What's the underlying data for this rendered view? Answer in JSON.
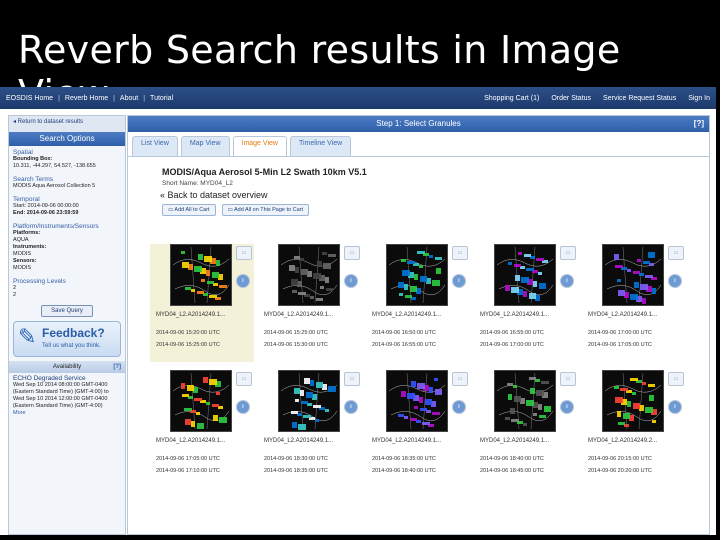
{
  "slide": {
    "title": "Reverb  Search results in Image View"
  },
  "topnav": {
    "left": [
      "EOSDIS Home",
      "Reverb Home",
      "About",
      "Tutorial"
    ],
    "right": [
      "Shopping Cart (1)",
      "Order Status",
      "Service Request Status",
      "Sign In"
    ]
  },
  "sidebar": {
    "return_link": "◂ Return to dataset results",
    "header": "Search Options",
    "spatial": {
      "heading": "Spatial",
      "label": "Bounding Box:",
      "value": "10.311, -44.297, 54.527, -138.655"
    },
    "terms": {
      "heading": "Search Terms",
      "value": "MODIS Aqua Aerosol Collection 5"
    },
    "temporal": {
      "heading": "Temporal",
      "start": "Start: 2014-09-06 00:00:00",
      "end": "End: 2014-09-06 23:59:59"
    },
    "platform": {
      "heading": "Platform/Instruments/Sensors",
      "platforms_label": "Platforms:",
      "platforms_value": "AQUA",
      "instruments_label": "Instruments:",
      "instruments_value": "MODIS",
      "sensors_label": "Sensors:",
      "sensors_value": "MODIS"
    },
    "processing": {
      "heading": "Processing Levels",
      "v1": "2",
      "v2": "2"
    },
    "save_query": "Save Query",
    "feedback": {
      "title": "Feedback?",
      "subtitle": "Tell us what you think."
    },
    "availability": {
      "label": "Availability",
      "help": "[?]"
    },
    "notice": {
      "heading": "ECHO Degraded Service",
      "body": "Wed Sep 10 2014 08:00:00 GMT-0400 (Eastern Standard Time) (GMT-4:00) to Wed Sep 10 2014 12:00:00 GMT-0400 (Eastern Standard Time) (GMT-4:00)",
      "more": "More"
    }
  },
  "main": {
    "header": "Step 1: Select Granules",
    "help": "[?]",
    "tabs": [
      "List View",
      "Map View",
      "Image View",
      "Timeline View"
    ],
    "active_tab": 2,
    "dataset_title": "MODIS/Aqua Aerosol 5-Min L2 Swath 10km V5.1",
    "short_name": "Short Name:   MYD04_L2",
    "back_link": "« Back to dataset overview",
    "add_all_cart": "Add All to Cart",
    "add_page_cart": "Add All on This Page to Cart"
  },
  "granules": [
    {
      "name": "MYD04_L2.A2014249.1...",
      "start": "2014-09-06 15:20:00 UTC",
      "end": "2014-09-06 15:25:00 UTC",
      "selected": true,
      "variant": 0
    },
    {
      "name": "MYD04_L2.A2014249.1...",
      "start": "2014-09-06 15:25:00 UTC",
      "end": "2014-09-06 15:30:00 UTC",
      "selected": false,
      "variant": 1
    },
    {
      "name": "MYD04_L2.A2014249.1...",
      "start": "2014-09-06 16:50:00 UTC",
      "end": "2014-09-06 16:55:00 UTC",
      "selected": false,
      "variant": 2
    },
    {
      "name": "MYD04_L2.A2014249.1...",
      "start": "2014-09-06 16:55:00 UTC",
      "end": "2014-09-06 17:00:00 UTC",
      "selected": false,
      "variant": 3
    },
    {
      "name": "MYD04_L2.A2014249.1...",
      "start": "2014-09-06 17:00:00 UTC",
      "end": "2014-09-06 17:05:00 UTC",
      "selected": false,
      "variant": 4
    },
    {
      "name": "MYD04_L2.A2014249.1...",
      "start": "2014-09-06 17:05:00 UTC",
      "end": "2014-09-06 17:10:00 UTC",
      "selected": false,
      "variant": 5
    },
    {
      "name": "MYD04_L2.A2014249.1...",
      "start": "2014-09-06 18:30:00 UTC",
      "end": "2014-09-06 18:35:00 UTC",
      "selected": false,
      "variant": 6
    },
    {
      "name": "MYD04_L2.A2014249.1...",
      "start": "2014-09-06 18:35:00 UTC",
      "end": "2014-09-06 18:40:00 UTC",
      "selected": false,
      "variant": 7
    },
    {
      "name": "MYD04_L2.A2014249.1...",
      "start": "2014-09-06 18:40:00 UTC",
      "end": "2014-09-06 18:45:00 UTC",
      "selected": false,
      "variant": 8
    },
    {
      "name": "MYD04_L2.A2014249.2...",
      "start": "2014-09-06 20:15:00 UTC",
      "end": "2014-09-06 20:20:00 UTC",
      "selected": false,
      "variant": 9
    }
  ],
  "tile_icons": {
    "cart": "cart-icon",
    "info": "info-icon",
    "cart_glyph": "▭",
    "info_glyph": "i"
  },
  "colors": {
    "nav": "#1d3a6c",
    "panel_header": "#2e5fa8",
    "active_tab": "#e07a10",
    "selected_tile": "#f3f1d8"
  }
}
